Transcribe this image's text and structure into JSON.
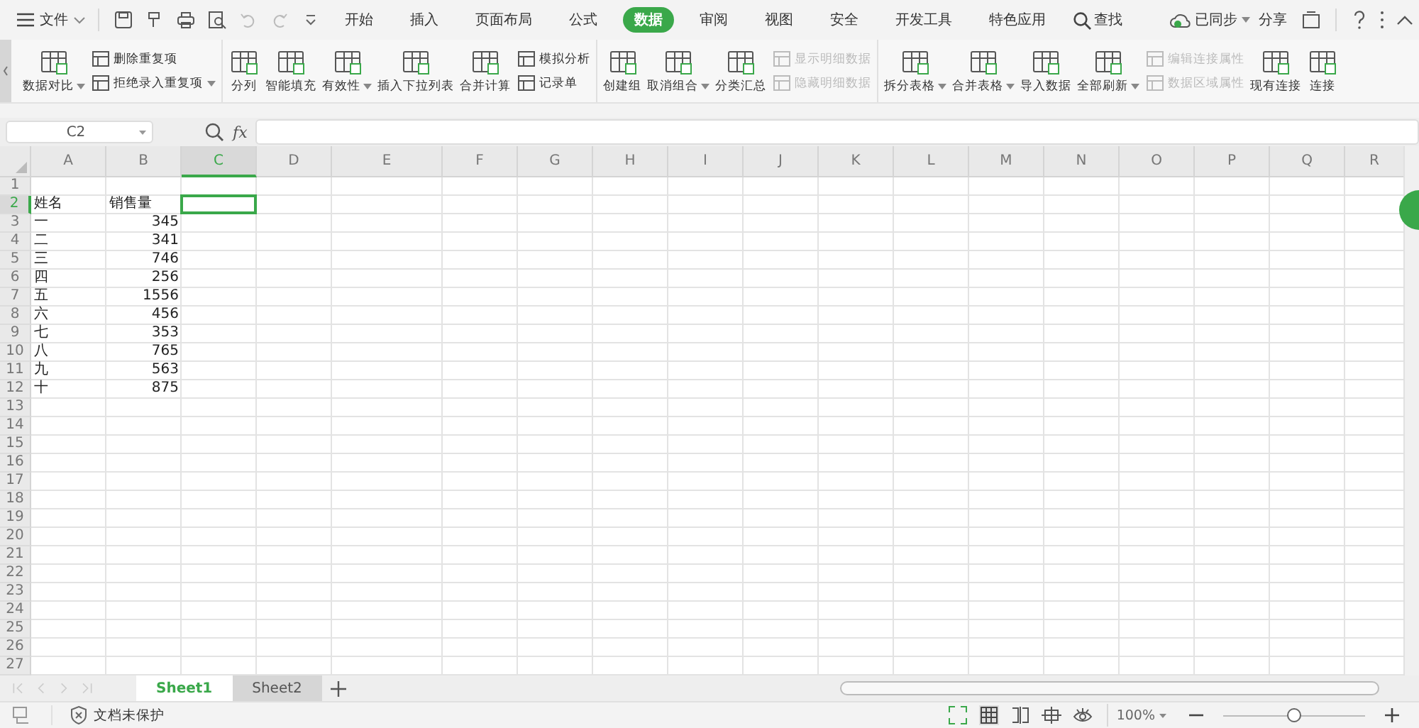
{
  "menu_bar": {
    "file_menu": "文件",
    "tabs": [
      {
        "label": "开始",
        "selected": false
      },
      {
        "label": "插入",
        "selected": false
      },
      {
        "label": "页面布局",
        "selected": false
      },
      {
        "label": "公式",
        "selected": false
      },
      {
        "label": "数据",
        "selected": true
      },
      {
        "label": "审阅",
        "selected": false
      },
      {
        "label": "视图",
        "selected": false
      },
      {
        "label": "安全",
        "selected": false
      },
      {
        "label": "开发工具",
        "selected": false
      },
      {
        "label": "特色应用",
        "selected": false
      }
    ],
    "search": "查找",
    "sync_status": "已同步",
    "share": "分享"
  },
  "ribbon": {
    "groups": [
      {
        "items": [
          {
            "kind": "large",
            "label": "数据对比",
            "dropdown": true,
            "disabled": false
          },
          {
            "kind": "stack",
            "items": [
              {
                "label": "删除重复项",
                "dropdown": false,
                "disabled": false
              },
              {
                "label": "拒绝录入重复项",
                "dropdown": true,
                "disabled": false
              }
            ]
          }
        ]
      },
      {
        "items": [
          {
            "kind": "large",
            "label": "分列",
            "dropdown": false,
            "disabled": false
          },
          {
            "kind": "large",
            "label": "智能填充",
            "dropdown": false,
            "disabled": false
          },
          {
            "kind": "large",
            "label": "有效性",
            "dropdown": true,
            "disabled": false
          },
          {
            "kind": "large",
            "label": "插入下拉列表",
            "dropdown": false,
            "disabled": false
          },
          {
            "kind": "large",
            "label": "合并计算",
            "dropdown": false,
            "disabled": false
          },
          {
            "kind": "stack",
            "items": [
              {
                "label": "模拟分析",
                "dropdown": false,
                "disabled": false
              },
              {
                "label": "记录单",
                "dropdown": false,
                "disabled": false
              }
            ]
          }
        ]
      },
      {
        "items": [
          {
            "kind": "large",
            "label": "创建组",
            "dropdown": false,
            "disabled": false
          },
          {
            "kind": "large",
            "label": "取消组合",
            "dropdown": true,
            "disabled": false
          },
          {
            "kind": "large",
            "label": "分类汇总",
            "dropdown": false,
            "disabled": false
          },
          {
            "kind": "stack",
            "items": [
              {
                "label": "显示明细数据",
                "dropdown": false,
                "disabled": true
              },
              {
                "label": "隐藏明细数据",
                "dropdown": false,
                "disabled": true
              }
            ]
          }
        ]
      },
      {
        "items": [
          {
            "kind": "large",
            "label": "拆分表格",
            "dropdown": true,
            "disabled": false
          },
          {
            "kind": "large",
            "label": "合并表格",
            "dropdown": true,
            "disabled": false
          },
          {
            "kind": "large",
            "label": "导入数据",
            "dropdown": false,
            "disabled": false
          },
          {
            "kind": "large",
            "label": "全部刷新",
            "dropdown": true,
            "disabled": false
          },
          {
            "kind": "stack",
            "items": [
              {
                "label": "编辑连接属性",
                "dropdown": false,
                "disabled": true
              },
              {
                "label": "数据区域属性",
                "dropdown": false,
                "disabled": true
              }
            ]
          },
          {
            "kind": "large",
            "label": "现有连接",
            "dropdown": false,
            "disabled": false
          },
          {
            "kind": "large",
            "label": "连接",
            "dropdown": false,
            "disabled": false
          }
        ]
      }
    ]
  },
  "formula_bar": {
    "name_box": "C2",
    "fx": "fx"
  },
  "sheet": {
    "columns": [
      {
        "label": "A",
        "selected": false
      },
      {
        "label": "B",
        "selected": false
      },
      {
        "label": "C",
        "selected": true
      },
      {
        "label": "D",
        "selected": false
      },
      {
        "label": "E",
        "selected": false
      },
      {
        "label": "F",
        "selected": false
      },
      {
        "label": "G",
        "selected": false
      },
      {
        "label": "H",
        "selected": false
      },
      {
        "label": "I",
        "selected": false
      },
      {
        "label": "J",
        "selected": false
      },
      {
        "label": "K",
        "selected": false
      },
      {
        "label": "L",
        "selected": false
      },
      {
        "label": "M",
        "selected": false
      },
      {
        "label": "N",
        "selected": false
      },
      {
        "label": "O",
        "selected": false
      },
      {
        "label": "P",
        "selected": false
      },
      {
        "label": "Q",
        "selected": false
      },
      {
        "label": "R",
        "selected": false
      }
    ],
    "rows": [
      {
        "label": "1",
        "selected": false,
        "cells": []
      },
      {
        "label": "2",
        "selected": true,
        "cells": [
          {
            "text": "姓名",
            "kind": "text"
          },
          {
            "text": "销售量",
            "kind": "text"
          }
        ]
      },
      {
        "label": "3",
        "selected": false,
        "cells": [
          {
            "text": "一",
            "kind": "text"
          },
          {
            "text": "345",
            "kind": "number"
          }
        ]
      },
      {
        "label": "4",
        "selected": false,
        "cells": [
          {
            "text": "二",
            "kind": "text"
          },
          {
            "text": "341",
            "kind": "number"
          }
        ]
      },
      {
        "label": "5",
        "selected": false,
        "cells": [
          {
            "text": "三",
            "kind": "text"
          },
          {
            "text": "746",
            "kind": "number"
          }
        ]
      },
      {
        "label": "6",
        "selected": false,
        "cells": [
          {
            "text": "四",
            "kind": "text"
          },
          {
            "text": "256",
            "kind": "number"
          }
        ]
      },
      {
        "label": "7",
        "selected": false,
        "cells": [
          {
            "text": "五",
            "kind": "text"
          },
          {
            "text": "1556",
            "kind": "number"
          }
        ]
      },
      {
        "label": "8",
        "selected": false,
        "cells": [
          {
            "text": "六",
            "kind": "text"
          },
          {
            "text": "456",
            "kind": "number"
          }
        ]
      },
      {
        "label": "9",
        "selected": false,
        "cells": [
          {
            "text": "七",
            "kind": "text"
          },
          {
            "text": "353",
            "kind": "number"
          }
        ]
      },
      {
        "label": "10",
        "selected": false,
        "cells": [
          {
            "text": "八",
            "kind": "text"
          },
          {
            "text": "765",
            "kind": "number"
          }
        ]
      },
      {
        "label": "11",
        "selected": false,
        "cells": [
          {
            "text": "九",
            "kind": "text"
          },
          {
            "text": "563",
            "kind": "number"
          }
        ]
      },
      {
        "label": "12",
        "selected": false,
        "cells": [
          {
            "text": "十",
            "kind": "text"
          },
          {
            "text": "875",
            "kind": "number"
          }
        ]
      },
      {
        "label": "13",
        "selected": false,
        "cells": []
      },
      {
        "label": "14",
        "selected": false,
        "cells": []
      },
      {
        "label": "15",
        "selected": false,
        "cells": []
      },
      {
        "label": "16",
        "selected": false,
        "cells": []
      },
      {
        "label": "17",
        "selected": false,
        "cells": []
      },
      {
        "label": "18",
        "selected": false,
        "cells": []
      },
      {
        "label": "19",
        "selected": false,
        "cells": []
      },
      {
        "label": "20",
        "selected": false,
        "cells": []
      },
      {
        "label": "21",
        "selected": false,
        "cells": []
      },
      {
        "label": "22",
        "selected": false,
        "cells": []
      },
      {
        "label": "23",
        "selected": false,
        "cells": []
      },
      {
        "label": "24",
        "selected": false,
        "cells": []
      },
      {
        "label": "25",
        "selected": false,
        "cells": []
      },
      {
        "label": "26",
        "selected": false,
        "cells": []
      },
      {
        "label": "27",
        "selected": false,
        "cells": []
      }
    ]
  },
  "sheet_tabs": [
    {
      "label": "Sheet1",
      "selected": true
    },
    {
      "label": "Sheet2",
      "selected": false
    }
  ],
  "status_bar": {
    "protection": "文档未保护",
    "zoom": "100%",
    "zoom_slider": {
      "level": 0.5
    }
  }
}
